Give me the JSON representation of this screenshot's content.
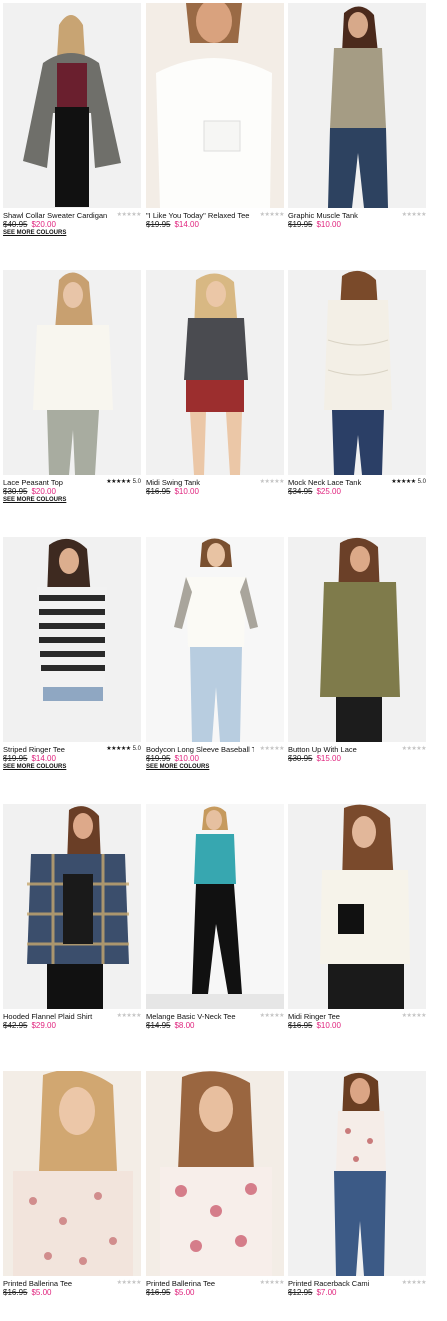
{
  "products": [
    {
      "name": "Shawl Collar Sweater Cardigan",
      "old_price": "$40.95",
      "price": "$20.00",
      "more_colours": "SEE MORE COLOURS",
      "rating": "",
      "stars": "★★★★★",
      "rated": false
    },
    {
      "name": "\"I Like You Today\" Relaxed Tee",
      "old_price": "$19.95",
      "price": "$14.00",
      "more_colours": "",
      "rating": "",
      "stars": "★★★★★",
      "rated": false
    },
    {
      "name": "Graphic Muscle Tank",
      "old_price": "$19.95",
      "price": "$10.00",
      "more_colours": "",
      "rating": "",
      "stars": "★★★★★",
      "rated": false
    },
    {
      "name": "Lace Peasant Top",
      "old_price": "$30.95",
      "price": "$20.00",
      "more_colours": "SEE MORE COLOURS",
      "rating": "5.0",
      "stars": "★★★★★",
      "rated": true
    },
    {
      "name": "Midi Swing Tank",
      "old_price": "$16.95",
      "price": "$10.00",
      "more_colours": "",
      "rating": "",
      "stars": "★★★★★",
      "rated": false
    },
    {
      "name": "Mock Neck Lace Tank",
      "old_price": "$34.95",
      "price": "$25.00",
      "more_colours": "",
      "rating": "5.0",
      "stars": "★★★★★",
      "rated": true
    },
    {
      "name": "Striped Ringer Tee",
      "old_price": "$19.95",
      "price": "$14.00",
      "more_colours": "SEE MORE COLOURS",
      "rating": "5.0",
      "stars": "★★★★★",
      "rated": true
    },
    {
      "name": "Bodycon Long Sleeve Baseball Tee",
      "old_price": "$19.95",
      "price": "$10.00",
      "more_colours": "SEE MORE COLOURS",
      "rating": "",
      "stars": "★★★★★",
      "rated": false
    },
    {
      "name": "Button Up With Lace",
      "old_price": "$30.95",
      "price": "$15.00",
      "more_colours": "",
      "rating": "",
      "stars": "★★★★★",
      "rated": false
    },
    {
      "name": "Hooded Flannel Plaid Shirt",
      "old_price": "$42.95",
      "price": "$29.00",
      "more_colours": "",
      "rating": "",
      "stars": "★★★★★",
      "rated": false
    },
    {
      "name": "Melange Basic V-Neck Tee",
      "old_price": "$14.95",
      "price": "$8.00",
      "more_colours": "",
      "rating": "",
      "stars": "★★★★★",
      "rated": false
    },
    {
      "name": "Midi Ringer Tee",
      "old_price": "$16.95",
      "price": "$10.00",
      "more_colours": "",
      "rating": "",
      "stars": "★★★★★",
      "rated": false
    },
    {
      "name": "Printed Ballerina Tee",
      "old_price": "$16.95",
      "price": "$5.00",
      "more_colours": "",
      "rating": "",
      "stars": "★★★★★",
      "rated": false
    },
    {
      "name": "Printed Ballerina Tee",
      "old_price": "$16.95",
      "price": "$5.00",
      "more_colours": "",
      "rating": "",
      "stars": "★★★★★",
      "rated": false
    },
    {
      "name": "Printed Racerback Cami",
      "old_price": "$12.95",
      "price": "$7.00",
      "more_colours": "",
      "rating": "",
      "stars": "★★★★★",
      "rated": false
    }
  ],
  "colors": {
    "sale_price": "#e0247e",
    "star_filled": "#111111",
    "star_empty": "#c4c4c4"
  }
}
